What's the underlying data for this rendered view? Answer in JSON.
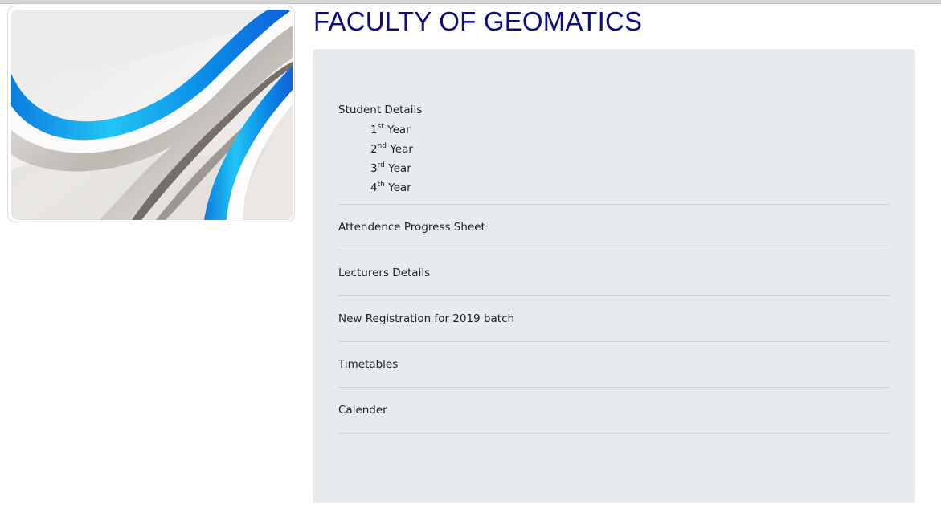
{
  "header": {
    "title": "FACULTY OF GEOMATICS"
  },
  "banner": {
    "icon": "abstract-wave-image",
    "colors": {
      "blue": "#1ea8f0",
      "silver": "#cfcac5",
      "dark": "#6e6660"
    }
  },
  "menu": {
    "student_details": {
      "label": "Student Details",
      "years": [
        {
          "num": "1",
          "sup": "st",
          "text": "Year"
        },
        {
          "num": "2",
          "sup": "nd",
          "text": "Year"
        },
        {
          "num": "3",
          "sup": "rd",
          "text": "Year"
        },
        {
          "num": "4",
          "sup": "th",
          "text": "Year"
        }
      ]
    },
    "items": [
      {
        "label": "Attendence Progress Sheet"
      },
      {
        "label": "Lecturers Details"
      },
      {
        "label": "New Registration for 2019 batch"
      },
      {
        "label": "Timetables"
      },
      {
        "label": "Calender"
      }
    ]
  },
  "theme": {
    "title_color": "#0d0d80",
    "panel_bg": "#e8ebee",
    "divider": "#cfd3d7"
  }
}
